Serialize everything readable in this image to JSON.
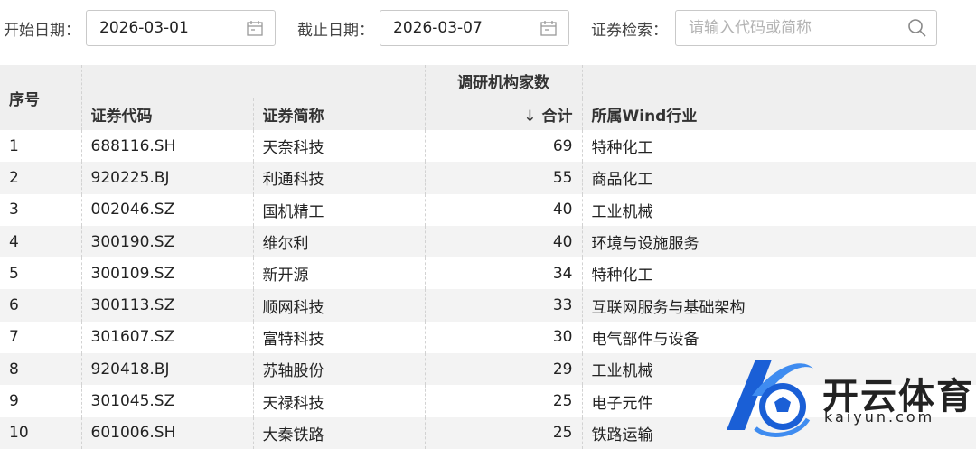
{
  "filters": {
    "start_label": "开始日期：",
    "start_value": "2026-03-01",
    "end_label": "截止日期：",
    "end_value": "2026-03-07",
    "search_label": "证券检索：",
    "search_placeholder": "请输入代码或简称"
  },
  "table": {
    "header_index": "序号",
    "header_group": "调研机构家数",
    "columns": {
      "code": "证券代码",
      "name": "证券简称",
      "total": "合计",
      "sort_arrow": "↓",
      "industry": "所属Wind行业"
    },
    "rows": [
      {
        "idx": "1",
        "code": "688116.SH",
        "name": "天奈科技",
        "total": "69",
        "industry": "特种化工"
      },
      {
        "idx": "2",
        "code": "920225.BJ",
        "name": "利通科技",
        "total": "55",
        "industry": "商品化工"
      },
      {
        "idx": "3",
        "code": "002046.SZ",
        "name": "国机精工",
        "total": "40",
        "industry": "工业机械"
      },
      {
        "idx": "4",
        "code": "300190.SZ",
        "name": "维尔利",
        "total": "40",
        "industry": "环境与设施服务"
      },
      {
        "idx": "5",
        "code": "300109.SZ",
        "name": "新开源",
        "total": "34",
        "industry": "特种化工"
      },
      {
        "idx": "6",
        "code": "300113.SZ",
        "name": "顺网科技",
        "total": "33",
        "industry": "互联网服务与基础架构"
      },
      {
        "idx": "7",
        "code": "301607.SZ",
        "name": "富特科技",
        "total": "30",
        "industry": "电气部件与设备"
      },
      {
        "idx": "8",
        "code": "920418.BJ",
        "name": "苏轴股份",
        "total": "29",
        "industry": "工业机械"
      },
      {
        "idx": "9",
        "code": "301045.SZ",
        "name": "天禄科技",
        "total": "25",
        "industry": "电子元件"
      },
      {
        "idx": "10",
        "code": "601006.SH",
        "name": "大秦铁路",
        "total": "25",
        "industry": "铁路运输"
      }
    ]
  },
  "watermark": {
    "name": "开云体育",
    "url": "kaiyun.com"
  },
  "colors": {
    "header_bg": "#efefef",
    "stripe_bg": "#f3f3f3",
    "logo_blue": "#1a5fd6"
  }
}
